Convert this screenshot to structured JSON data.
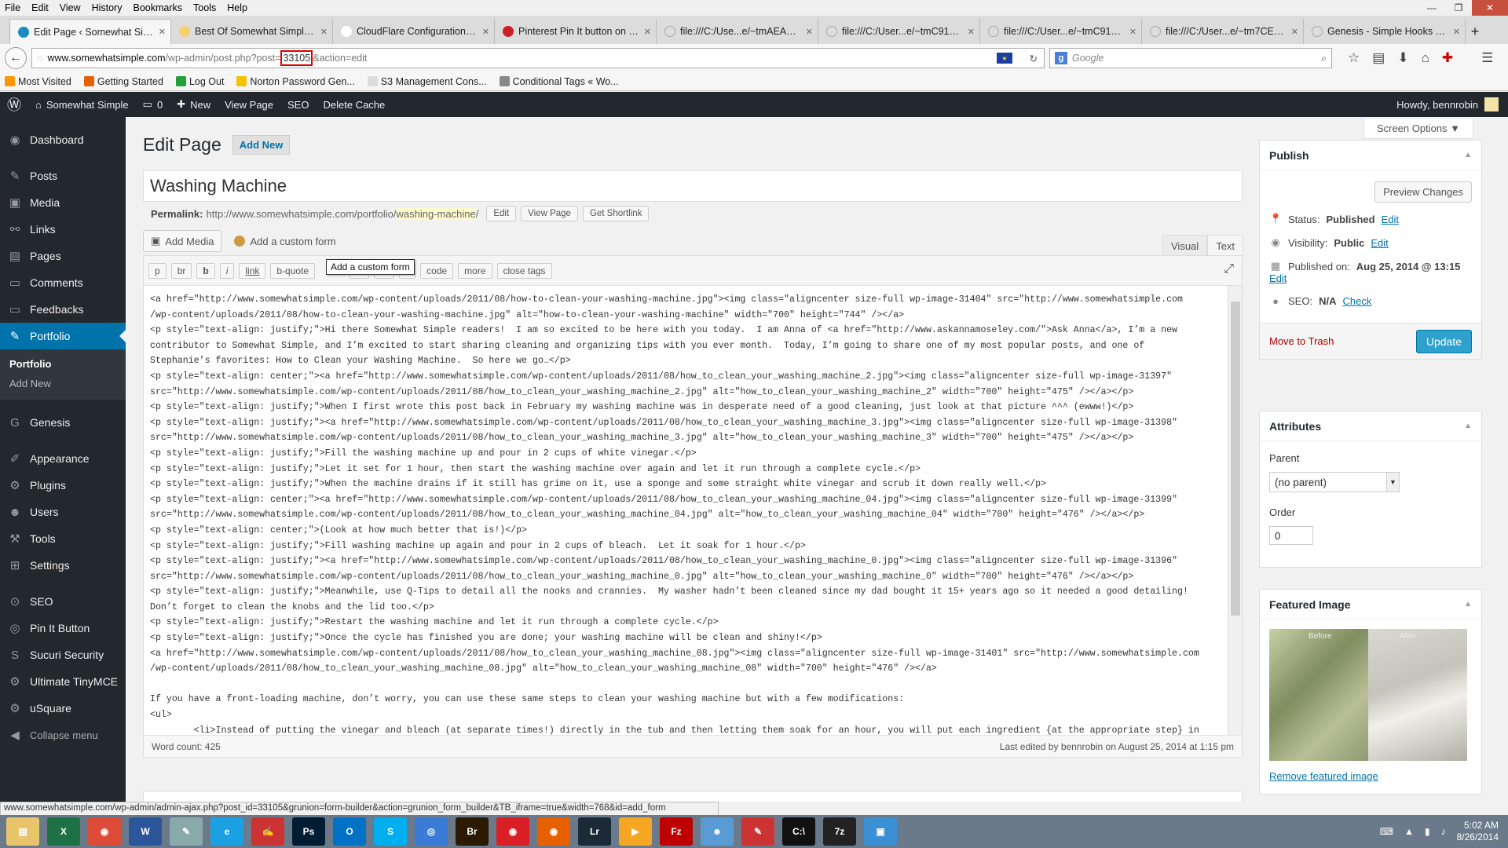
{
  "menubar": [
    "File",
    "Edit",
    "View",
    "History",
    "Bookmarks",
    "Tools",
    "Help"
  ],
  "tabs": [
    {
      "label": "Edit Page ‹ Somewhat Simple ...",
      "color": "#1e8cbe",
      "active": true
    },
    {
      "label": "Best Of Somewhat Simple ...",
      "color": "#f4d06f"
    },
    {
      "label": "CloudFlare Configuration ‹ So...",
      "color": "#ffffff"
    },
    {
      "label": "Pinterest Pin It button on i...",
      "color": "#cb2027"
    },
    {
      "label": "file:///C:/Use...e/~tmAEAF.html",
      "color": ""
    },
    {
      "label": "file:///C:/User...e/~tmC917.html",
      "color": ""
    },
    {
      "label": "file:///C:/User...e/~tmC917.html",
      "color": ""
    },
    {
      "label": "file:///C:/User...e/~tm7CE2.html",
      "color": ""
    },
    {
      "label": "Genesis - Simple Hooks ‹ Som...",
      "color": ""
    }
  ],
  "url": {
    "prefix": "www.somewhatsimple.com",
    "path": "/wp-admin/post.php?post=",
    "id": "33105",
    "suffix": "&action=edit"
  },
  "search_placeholder": "Google",
  "bookmarks": [
    {
      "label": "Most Visited",
      "color": "#ff9500"
    },
    {
      "label": "Getting Started",
      "color": "#e66000"
    },
    {
      "label": "Log Out",
      "color": "#23a036"
    },
    {
      "label": "Norton Password Gen...",
      "color": "#f6c100"
    },
    {
      "label": "S3 Management Cons...",
      "color": "#dddddd"
    },
    {
      "label": "Conditional Tags « Wo...",
      "color": "#888888"
    }
  ],
  "adminbar": {
    "site": "Somewhat Simple",
    "comments": "0",
    "new": "New",
    "view_page": "View Page",
    "seo": "SEO",
    "delete_cache": "Delete Cache",
    "howdy": "Howdy, bennrobin"
  },
  "sidebar": [
    {
      "label": "Dashboard",
      "icon": "◉"
    },
    {
      "sep": true
    },
    {
      "label": "Posts",
      "icon": "✎"
    },
    {
      "label": "Media",
      "icon": "▣"
    },
    {
      "label": "Links",
      "icon": "⚯"
    },
    {
      "label": "Pages",
      "icon": "▤"
    },
    {
      "label": "Comments",
      "icon": "▭"
    },
    {
      "label": "Feedbacks",
      "icon": "▭"
    },
    {
      "label": "Portfolio",
      "icon": "✎",
      "current": true
    },
    {
      "submenu": [
        "Portfolio",
        "Add New"
      ]
    },
    {
      "sep": true
    },
    {
      "label": "Genesis",
      "icon": "G"
    },
    {
      "sep": true
    },
    {
      "label": "Appearance",
      "icon": "✐"
    },
    {
      "label": "Plugins",
      "icon": "⚙"
    },
    {
      "label": "Users",
      "icon": "☻"
    },
    {
      "label": "Tools",
      "icon": "⚒"
    },
    {
      "label": "Settings",
      "icon": "⊞"
    },
    {
      "sep": true
    },
    {
      "label": "SEO",
      "icon": "⊙"
    },
    {
      "label": "Pin It Button",
      "icon": "◎"
    },
    {
      "label": "Sucuri Security",
      "icon": "S"
    },
    {
      "label": "Ultimate TinyMCE",
      "icon": "⚙"
    },
    {
      "label": "uSquare",
      "icon": "⚙"
    },
    {
      "label": "Collapse menu",
      "icon": "◀",
      "collapse": true
    }
  ],
  "page": {
    "screen_options": "Screen Options ▼",
    "title": "Edit Page",
    "add_new": "Add New",
    "post_title": "Washing Machine",
    "permalink_label": "Permalink:",
    "permalink_base": "http://www.somewhatsimple.com/portfolio/",
    "permalink_slug": "washing-machine",
    "permalink_end": "/",
    "edit_btn": "Edit",
    "view_page_btn": "View Page",
    "shortlink_btn": "Get Shortlink",
    "add_media": "Add Media",
    "add_custom_form": "Add a custom form",
    "tab_visual": "Visual",
    "tab_text": "Text",
    "qtags": [
      "p",
      "br",
      "b",
      "i",
      "link",
      "b-quote",
      "del",
      "ul",
      "ol",
      "li",
      "code",
      "more",
      "close tags"
    ],
    "tooltip": "Add a custom form",
    "word_count": "Word count: 425",
    "last_edited": "Last edited by bennrobin on August 25, 2014 at 1:15 pm"
  },
  "code_lines": [
    "<a href=\"http://www.somewhatsimple.com/wp-content/uploads/2011/08/how-to-clean-your-washing-machine.jpg\"><img class=\"aligncenter size-full wp-image-31404\" src=\"http://www.somewhatsimple.com",
    "/wp-content/uploads/2011/08/how-to-clean-your-washing-machine.jpg\" alt=\"how-to-clean-your-washing-machine\" width=\"700\" height=\"744\" /></a>",
    "<p style=\"text-align: justify;\">Hi there Somewhat Simple readers!  I am so excited to be here with you today.  I am Anna of <a href=\"http://www.askannamoseley.com/\">Ask Anna</a>, I’m a new",
    "contributor to Somewhat Simple, and I’m excited to start sharing cleaning and organizing tips with you ever month.  Today, I’m going to share one of my most popular posts, and one of",
    "Stephanie’s favorites: How to Clean your Washing Machine.  So here we go…</p>",
    "<p style=\"text-align: center;\"><a href=\"http://www.somewhatsimple.com/wp-content/uploads/2011/08/how_to_clean_your_washing_machine_2.jpg\"><img class=\"aligncenter size-full wp-image-31397\"",
    "src=\"http://www.somewhatsimple.com/wp-content/uploads/2011/08/how_to_clean_your_washing_machine_2.jpg\" alt=\"how_to_clean_your_washing_machine_2\" width=\"700\" height=\"475\" /></a></p>",
    "<p style=\"text-align: justify;\">When I first wrote this post back in February my washing machine was in desperate need of a good cleaning, just look at that picture ^^^ (ewww!)</p>",
    "<p style=\"text-align: justify;\"><a href=\"http://www.somewhatsimple.com/wp-content/uploads/2011/08/how_to_clean_your_washing_machine_3.jpg\"><img class=\"aligncenter size-full wp-image-31398\"",
    "src=\"http://www.somewhatsimple.com/wp-content/uploads/2011/08/how_to_clean_your_washing_machine_3.jpg\" alt=\"how_to_clean_your_washing_machine_3\" width=\"700\" height=\"475\" /></a></p>",
    "<p style=\"text-align: justify;\">Fill the washing machine up and pour in 2 cups of white vinegar.</p>",
    "<p style=\"text-align: justify;\">Let it set for 1 hour, then start the washing machine over again and let it run through a complete cycle.</p>",
    "<p style=\"text-align: justify;\">When the machine drains if it still has grime on it, use a sponge and some straight white vinegar and scrub it down really well.</p>",
    "<p style=\"text-align: center;\"><a href=\"http://www.somewhatsimple.com/wp-content/uploads/2011/08/how_to_clean_your_washing_machine_04.jpg\"><img class=\"aligncenter size-full wp-image-31399\"",
    "src=\"http://www.somewhatsimple.com/wp-content/uploads/2011/08/how_to_clean_your_washing_machine_04.jpg\" alt=\"how_to_clean_your_washing_machine_04\" width=\"700\" height=\"476\" /></a></p>",
    "<p style=\"text-align: center;\">(Look at how much better that is!)</p>",
    "<p style=\"text-align: justify;\">Fill washing machine up again and pour in 2 cups of bleach.  Let it soak for 1 hour.</p>",
    "<p style=\"text-align: justify;\"><a href=\"http://www.somewhatsimple.com/wp-content/uploads/2011/08/how_to_clean_your_washing_machine_0.jpg\"><img class=\"aligncenter size-full wp-image-31396\"",
    "src=\"http://www.somewhatsimple.com/wp-content/uploads/2011/08/how_to_clean_your_washing_machine_0.jpg\" alt=\"how_to_clean_your_washing_machine_0\" width=\"700\" height=\"476\" /></a></p>",
    "<p style=\"text-align: justify;\">Meanwhile, use Q-Tips to detail all the nooks and crannies.  My washer hadn’t been cleaned since my dad bought it 15+ years ago so it needed a good detailing!",
    "Don’t forget to clean the knobs and the lid too.</p>",
    "<p style=\"text-align: justify;\">Restart the washing machine and let it run through a complete cycle.</p>",
    "<p style=\"text-align: justify;\">Once the cycle has finished you are done; your washing machine will be clean and shiny!</p>",
    "<a href=\"http://www.somewhatsimple.com/wp-content/uploads/2011/08/how_to_clean_your_washing_machine_08.jpg\"><img class=\"aligncenter size-full wp-image-31401\" src=\"http://www.somewhatsimple.com",
    "/wp-content/uploads/2011/08/how_to_clean_your_washing_machine_08.jpg\" alt=\"how_to_clean_your_washing_machine_08\" width=\"700\" height=\"476\" /></a>",
    "",
    "If you have a front-loading machine, don’t worry, you can use these same steps to clean your washing machine but with a few modifications:",
    "<ul>",
    "        <li>Instead of putting the vinegar and bleach (at separate times!) directly in the tub and then letting them soak for an hour, you will put each ingredient {at the appropriate step} in"
  ],
  "publish": {
    "title": "Publish",
    "preview": "Preview Changes",
    "status_label": "Status:",
    "status": "Published",
    "status_edit": "Edit",
    "visibility_label": "Visibility:",
    "visibility": "Public",
    "visibility_edit": "Edit",
    "published_label": "Published on:",
    "published": "Aug 25, 2014 @ 13:15",
    "published_edit": "Edit",
    "seo_label": "SEO:",
    "seo": "N/A",
    "seo_check": "Check",
    "trash": "Move to Trash",
    "update": "Update"
  },
  "attributes": {
    "title": "Attributes",
    "parent_label": "Parent",
    "parent_value": "(no parent)",
    "order_label": "Order",
    "order_value": "0"
  },
  "featured": {
    "title": "Featured Image",
    "before": "Before",
    "after": "After",
    "remove": "Remove featured image"
  },
  "status_url": "www.somewhatsimple.com/wp-admin/admin-ajax.php?post_id=33105&grunion=form-builder&action=grunion_form_builder&TB_iframe=true&width=768&id=add_form",
  "taskbar": [
    {
      "label": "▤",
      "color": "#e8c46a"
    },
    {
      "label": "X",
      "color": "#1e7145"
    },
    {
      "label": "◉",
      "color": "#dd4b39"
    },
    {
      "label": "W",
      "color": "#2b579a"
    },
    {
      "label": "✎",
      "color": "#8aa"
    },
    {
      "label": "e",
      "color": "#1ba1e2"
    },
    {
      "label": "✍",
      "color": "#c33"
    },
    {
      "label": "Ps",
      "color": "#001d34"
    },
    {
      "label": "O",
      "color": "#0072c6"
    },
    {
      "label": "S",
      "color": "#00aff0"
    },
    {
      "label": "◎",
      "color": "#3a7bd5"
    },
    {
      "label": "Br",
      "color": "#2b1a00"
    },
    {
      "label": "◉",
      "color": "#da1f26"
    },
    {
      "label": "◉",
      "color": "#e66000"
    },
    {
      "label": "Lr",
      "color": "#1c2a38"
    },
    {
      "label": "▶",
      "color": "#f5a623"
    },
    {
      "label": "Fz",
      "color": "#bf0000"
    },
    {
      "label": "☻",
      "color": "#5a9bd5"
    },
    {
      "label": "✎",
      "color": "#c33"
    },
    {
      "label": "C:\\",
      "color": "#111"
    },
    {
      "label": "7z",
      "color": "#222"
    },
    {
      "label": "▣",
      "color": "#3a8fd5"
    }
  ],
  "clock": {
    "time": "5:02 AM",
    "date": "8/26/2014"
  },
  "colors": {
    "accent": "#0073aa",
    "adminbar": "#23282d",
    "update": "#2ea2cc",
    "trash": "#a00"
  }
}
